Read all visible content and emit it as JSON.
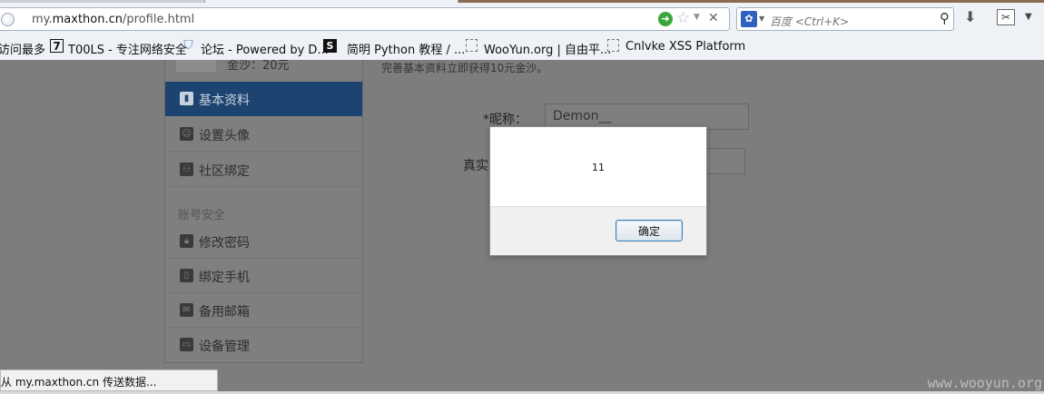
{
  "browser": {
    "url_prefix": "my.",
    "url_domain": "maxthon.cn",
    "url_path": "/profile.html",
    "search_placeholder": "百度 <Ctrl+K>",
    "bookmarks": [
      {
        "label": "访问最多",
        "icon": "none"
      },
      {
        "label": "T00LS - 专注网络安全",
        "icon": "seven"
      },
      {
        "label": "论坛 - Powered by D...",
        "icon": "shield"
      },
      {
        "label": "简明 Python 教程 / ...",
        "icon": "s"
      },
      {
        "label": "WooYun.org | 自由平...",
        "icon": "blank"
      },
      {
        "label": "Cnlvke XSS Platform",
        "icon": "blank"
      }
    ],
    "status_text": "正从 my.maxthon.cn 传送数据..."
  },
  "sidebar": {
    "coins": "金沙：20元",
    "items": [
      {
        "label": "基本资料",
        "active": true
      },
      {
        "label": "设置头像",
        "active": false
      },
      {
        "label": "社区绑定",
        "active": false
      }
    ],
    "security_header": "账号安全",
    "security_items": [
      {
        "label": "修改密码"
      },
      {
        "label": "绑定手机"
      },
      {
        "label": "备用邮箱"
      },
      {
        "label": "设备管理"
      }
    ]
  },
  "profile": {
    "tip": "完善基本资料立即获得10元金沙。",
    "nickname_label": "*昵称：",
    "nickname_value": "Demon__",
    "realname_label": "真实"
  },
  "dialog": {
    "message": "11",
    "ok_label": "确定"
  },
  "watermark": "www.wooyun.org"
}
